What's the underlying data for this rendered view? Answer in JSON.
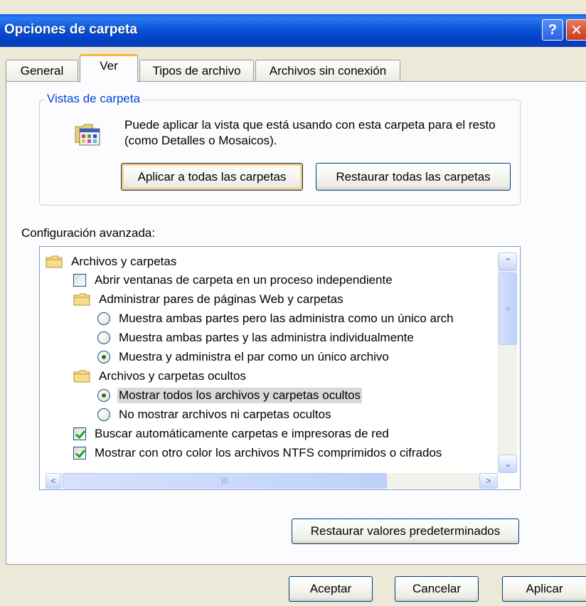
{
  "window": {
    "title": "Opciones de carpeta",
    "help_glyph": "?",
    "close_glyph": "✕"
  },
  "tabs": [
    {
      "label": "General",
      "active": false
    },
    {
      "label": "Ver",
      "active": true
    },
    {
      "label": "Tipos de archivo",
      "active": false
    },
    {
      "label": "Archivos sin conexión",
      "active": false
    }
  ],
  "folder_views": {
    "group_label": "Vistas de carpeta",
    "description": "Puede aplicar la vista que está usando con esta carpeta para el resto (como Detalles o Mosaicos).",
    "apply_all_label": "Aplicar a todas las carpetas",
    "reset_all_label": "Restaurar todas las carpetas"
  },
  "advanced": {
    "label": "Configuración avanzada:",
    "items": [
      {
        "type": "folder",
        "label": "Archivos y carpetas",
        "level": 0
      },
      {
        "type": "checkbox",
        "label": "Abrir ventanas de carpeta  en un proceso independiente",
        "checked": false,
        "level": 1
      },
      {
        "type": "folder",
        "label": "Administrar pares de páginas Web y carpetas",
        "level": 1
      },
      {
        "type": "radio",
        "label": "Muestra ambas partes pero las administra como un único arch",
        "checked": false,
        "level": 2
      },
      {
        "type": "radio",
        "label": "Muestra ambas partes y las administra individualmente",
        "checked": false,
        "level": 2
      },
      {
        "type": "radio",
        "label": "Muestra y administra el par como un único archivo",
        "checked": true,
        "level": 2
      },
      {
        "type": "folder",
        "label": "Archivos y carpetas ocultos",
        "level": 1
      },
      {
        "type": "radio",
        "label": "Mostrar todos los archivos y carpetas ocultos",
        "checked": true,
        "level": 2,
        "selected": true
      },
      {
        "type": "radio",
        "label": "No mostrar archivos ni carpetas ocultos",
        "checked": false,
        "level": 2
      },
      {
        "type": "checkbox",
        "label": "Buscar automáticamente carpetas e impresoras de red",
        "checked": true,
        "level": 1
      },
      {
        "type": "checkbox",
        "label": "Mostrar con otro color los archivos NTFS comprimidos o cifrados",
        "checked": true,
        "level": 1
      }
    ],
    "restore_defaults_label": "Restaurar valores predeterminados"
  },
  "footer": {
    "ok_label": "Aceptar",
    "cancel_label": "Cancelar",
    "apply_label": "Aplicar"
  },
  "colors": {
    "titlebar": "#0b55d8",
    "group_label": "#0046d5",
    "active_tab_accent": "#f5b646",
    "selection": "#d9d9d9"
  },
  "scrollbars": {
    "up_glyph": "⌃",
    "down_glyph": "⌄",
    "left_glyph": "<",
    "right_glyph": ">",
    "grip_v": "≡",
    "grip_h": "III"
  }
}
